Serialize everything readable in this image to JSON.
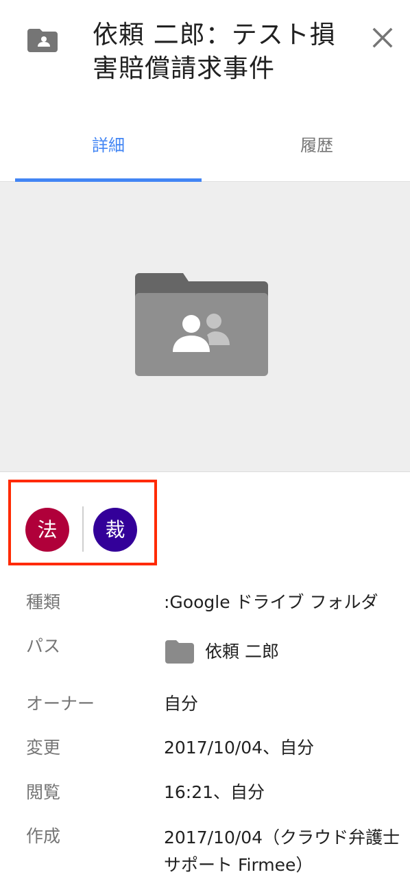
{
  "header": {
    "title": "依頼 二郎：テスト損害賠償請求事件",
    "close_label": "×"
  },
  "tabs": [
    {
      "label": "詳細",
      "active": true
    },
    {
      "label": "履歴",
      "active": false
    }
  ],
  "colors": {
    "accent": "#4285f4",
    "badge_law": "#b0003a",
    "badge_court": "#330099",
    "highlight_box": "#ff2a00",
    "folder_gray": "#8a8a8a"
  },
  "badges": [
    {
      "label": "法",
      "icon": "law-badge"
    },
    {
      "label": "裁",
      "icon": "court-badge"
    }
  ],
  "details": {
    "type": {
      "label": "種類",
      "value": ":Google ドライブ フォルダ"
    },
    "path": {
      "label": "パス",
      "value": "依頼 二郎",
      "icon": "folder-icon"
    },
    "owner": {
      "label": "オーナー",
      "value": "自分"
    },
    "modified": {
      "label": "変更",
      "value": "2017/10/04、自分"
    },
    "viewed": {
      "label": "閲覧",
      "value": "16:21、自分"
    },
    "created": {
      "label": "作成",
      "value": "2017/10/04（クラウド弁護士サポート Firmee）"
    }
  }
}
